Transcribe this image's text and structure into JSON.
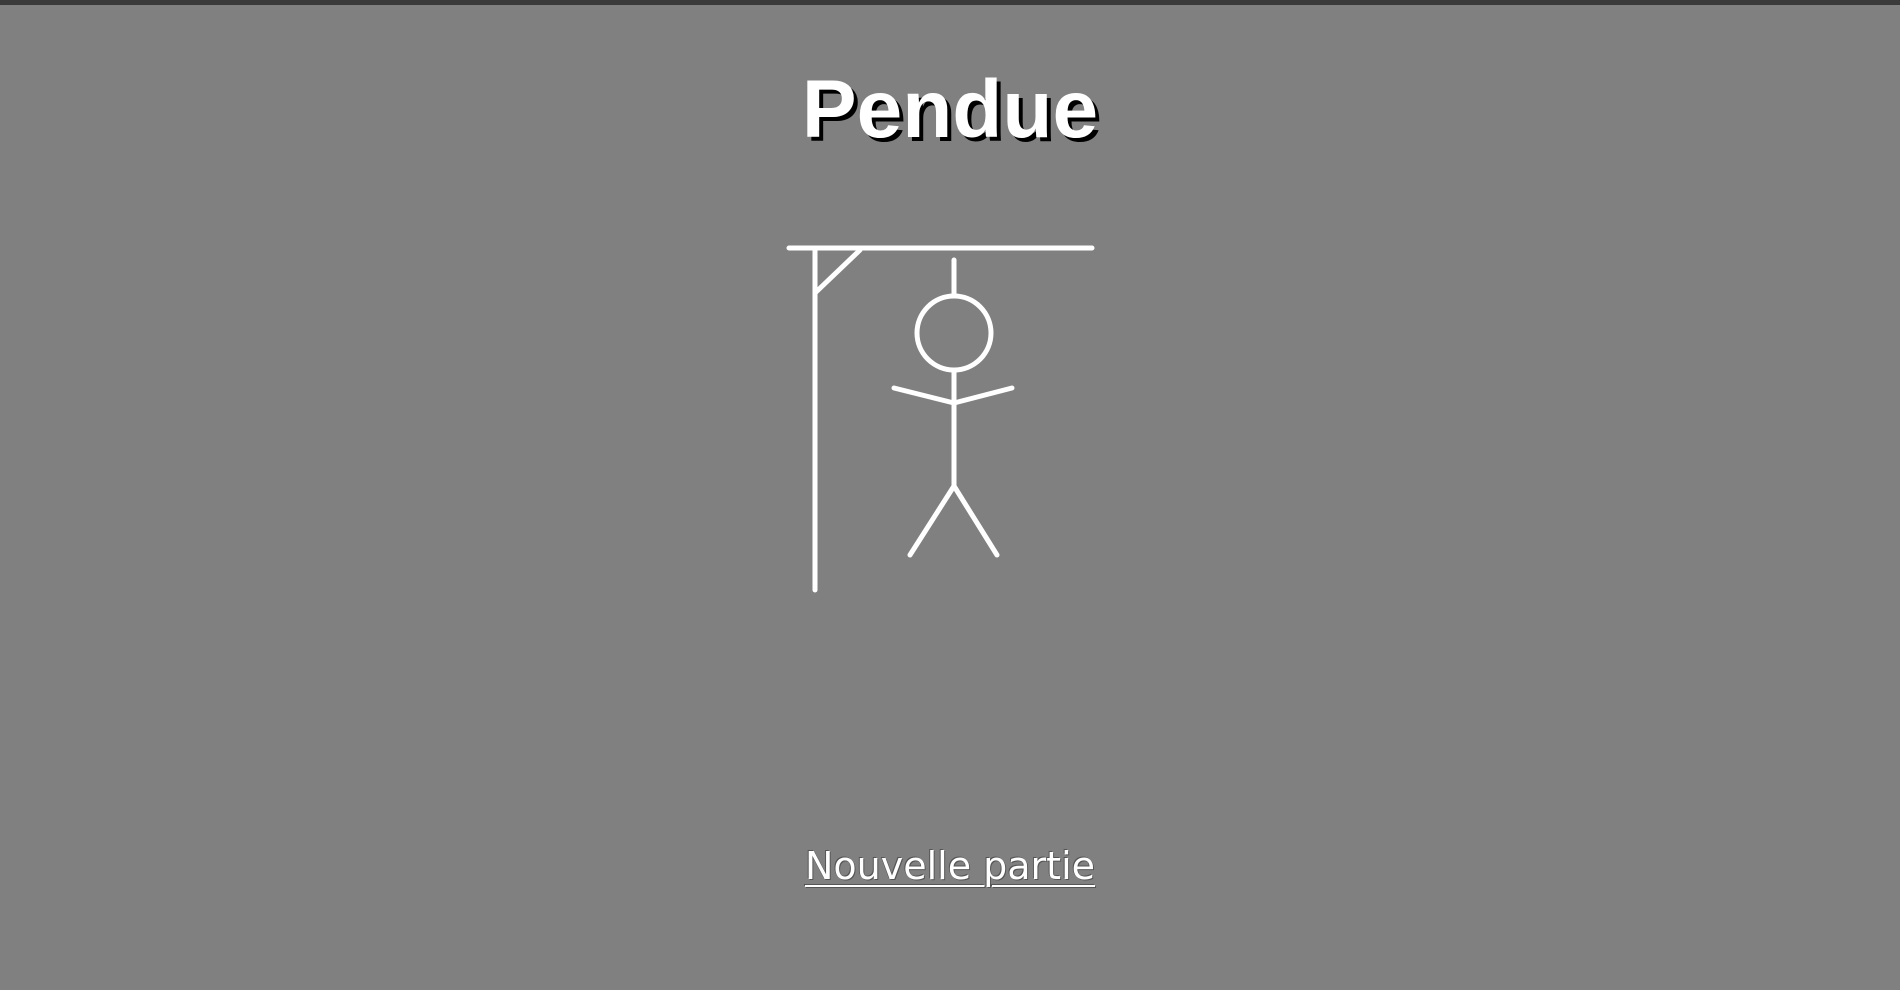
{
  "page": {
    "title": "Pendue",
    "background_color": "#808080",
    "foreground_color": "#ffffff"
  },
  "game": {
    "errors_shown": 10,
    "hangman_parts": [
      "base-post",
      "top-beam",
      "brace",
      "rope",
      "head",
      "body",
      "left-arm",
      "right-arm",
      "left-leg",
      "right-leg"
    ]
  },
  "actions": {
    "new_game_label": "Nouvelle partie"
  }
}
